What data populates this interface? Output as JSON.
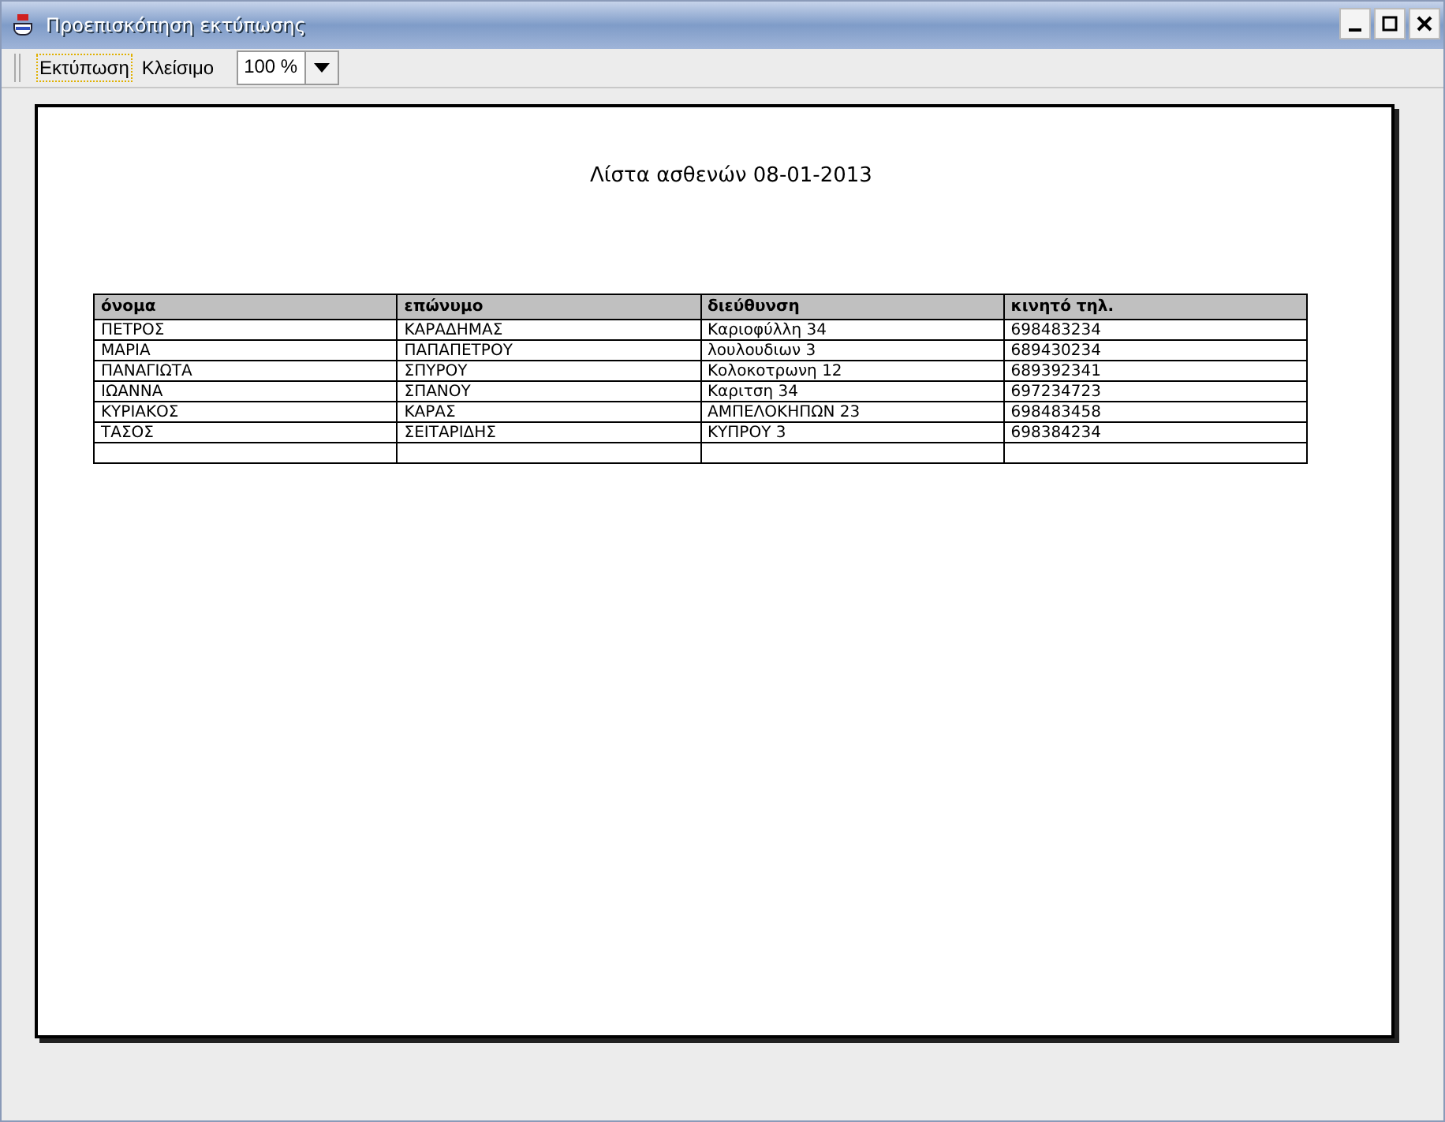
{
  "window": {
    "title": "Προεπισκόπηση εκτύπωσης"
  },
  "toolbar": {
    "buttons": [
      {
        "label": "Εκτύπωση",
        "focused": true
      },
      {
        "label": "Κλείσιμο",
        "focused": false
      }
    ],
    "zoom": {
      "value": "100 %"
    }
  },
  "page": {
    "title": "Λίστα ασθενών 08-01-2013",
    "table": {
      "columns": [
        "όνομα",
        "επώνυμο",
        "διεύθυνση",
        "κινητό τηλ."
      ],
      "rows": [
        [
          "ΠΕΤΡΟΣ",
          "ΚΑΡΑΔΗΜΑΣ",
          "Καριοφύλλη 34",
          "698483234"
        ],
        [
          "ΜΑΡΙΑ",
          "ΠΑΠΑΠΕΤΡΟΥ",
          "λουλουδιων 3",
          "689430234"
        ],
        [
          "ΠΑΝΑΓΙΩΤΑ",
          "ΣΠΥΡΟΥ",
          "Κολοκοτρωνη 12",
          "689392341"
        ],
        [
          "ΙΩΑΝΝΑ",
          "ΣΠΑΝΟΥ",
          "Καριτση 34",
          "697234723"
        ],
        [
          "ΚΥΡΙΑΚΟΣ",
          "ΚΑΡΑΣ",
          "ΑΜΠΕΛΟΚΗΠΩΝ 23",
          "698483458"
        ],
        [
          "ΤΑΣΟΣ",
          "ΣΕΙΤΑΡΙΔΗΣ",
          "ΚΥΠΡΟΥ 3",
          "698384234"
        ]
      ]
    }
  }
}
